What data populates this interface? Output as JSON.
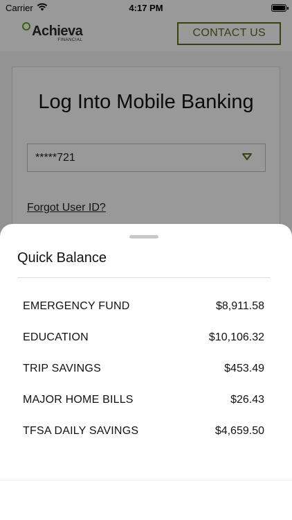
{
  "status_bar": {
    "carrier": "Carrier",
    "time": "4:17 PM",
    "icons": [
      "wifi-icon",
      "battery-icon"
    ]
  },
  "header": {
    "logo_name": "Achieva",
    "logo_sub": "FINANCIAL",
    "contact_label": "CONTACT US",
    "accent_color": "#5a6a24"
  },
  "login": {
    "title": "Log Into Mobile Banking",
    "user_id_value": "*****721",
    "forgot_label": "Forgot User ID?"
  },
  "quick_balance": {
    "title": "Quick Balance",
    "accounts": [
      {
        "name": "EMERGENCY FUND",
        "balance": "$8,911.58"
      },
      {
        "name": "EDUCATION",
        "balance": "$10,106.32"
      },
      {
        "name": "TRIP SAVINGS",
        "balance": "$453.49"
      },
      {
        "name": "MAJOR HOME BILLS",
        "balance": "$26.43"
      },
      {
        "name": "TFSA DAILY SAVINGS",
        "balance": "$4,659.50"
      }
    ]
  }
}
